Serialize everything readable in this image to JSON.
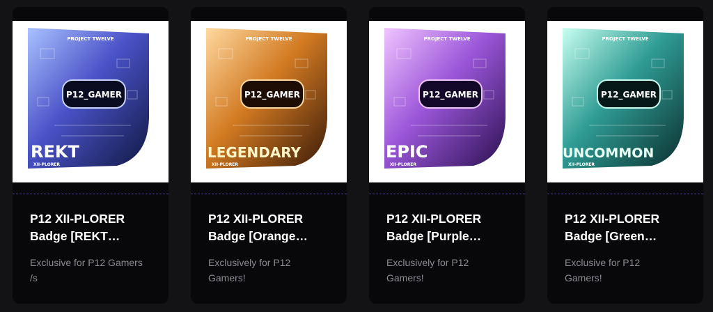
{
  "products": [
    {
      "title_line1": "P12 XII-PLORER",
      "title_line2": "Badge [REKT…",
      "desc_line1": "Exclusive for P12 Gamers",
      "desc_line2": "/s",
      "badge": {
        "brand": "PROJECT TWELVE",
        "visor": "P12_GAMER",
        "rank": "REKT",
        "sub": "XII-PLORER",
        "color_light": "#a9c2ff",
        "color_mid": "#4a52c8",
        "color_dark": "#101842"
      }
    },
    {
      "title_line1": "P12 XII-PLORER",
      "title_line2": "Badge [Orange…",
      "desc_line1": "Exclusively for P12",
      "desc_line2": "Gamers!",
      "badge": {
        "brand": "PROJECT TWELVE",
        "visor": "P12_GAMER",
        "rank": "LEGENDARY",
        "sub": "XII-PLORER",
        "color_light": "#ffd9a0",
        "color_mid": "#d27a22",
        "color_dark": "#3a1a08"
      }
    },
    {
      "title_line1": "P12 XII-PLORER",
      "title_line2": "Badge [Purple…",
      "desc_line1": "Exclusively for P12",
      "desc_line2": "Gamers!",
      "badge": {
        "brand": "PROJECT TWELVE",
        "visor": "P12_GAMER",
        "rank": "EPIC",
        "sub": "XII-PLORER",
        "color_light": "#f0c4ff",
        "color_mid": "#9b56d9",
        "color_dark": "#2a1050"
      }
    },
    {
      "title_line1": "P12 XII-PLORER",
      "title_line2": "Badge [Green…",
      "desc_line1": "Exclusive for P12",
      "desc_line2": "Gamers!",
      "badge": {
        "brand": "PROJECT TWELVE",
        "visor": "P12_GAMER",
        "rank": "UNCOMMON",
        "sub": "XII-PLORER",
        "color_light": "#c8fff0",
        "color_mid": "#2f9c94",
        "color_dark": "#0b2e2e"
      }
    }
  ]
}
